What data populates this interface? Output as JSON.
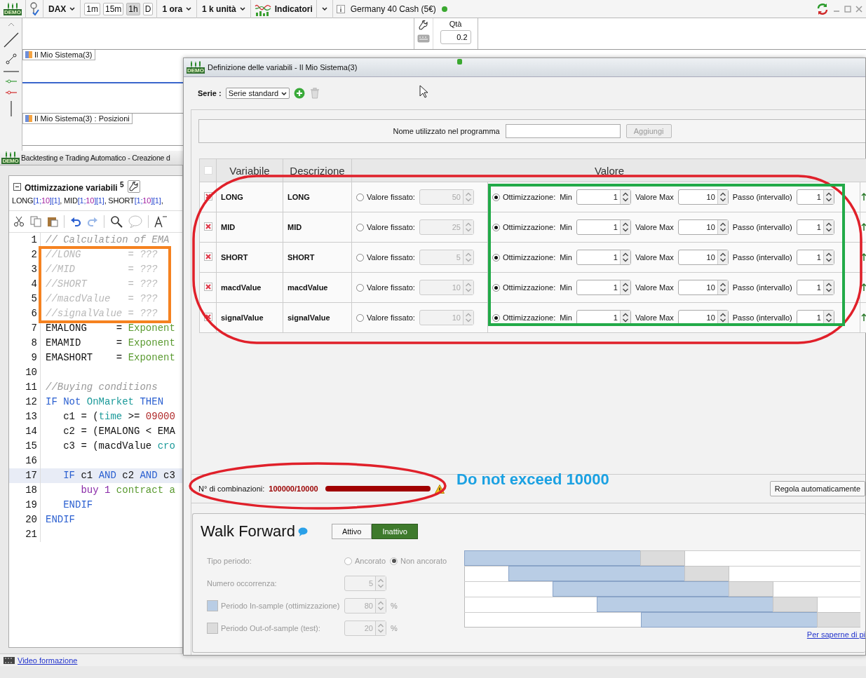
{
  "toolbar": {
    "logo_text": "DEMO",
    "symbol": "DAX",
    "timeframes": [
      {
        "label": "1m",
        "selected": false
      },
      {
        "label": "15m",
        "selected": false
      },
      {
        "label": "1h",
        "selected": true
      },
      {
        "label": "D",
        "selected": false
      }
    ],
    "period": "1 ora",
    "units": "1 k unità",
    "indicators": "Indicatori",
    "instrument": "Germany 40 Cash (5€)"
  },
  "order_panel": {
    "quantity_label": "Qtà",
    "quantity": "0.2"
  },
  "chart_panels": [
    {
      "label": "Il Mio Sistema(3)"
    },
    {
      "label": "Il Mio Sistema(3) : Posizioni"
    }
  ],
  "backtest_window": {
    "logo_text": "DEMO",
    "title": "Backtesting e Trading Automatico - Creazione d",
    "section_title": "Ottimizzazione variabili $^{5}$",
    "variables_summary": [
      {
        "text": "LONG",
        "kind": "name"
      },
      {
        "text": "[1;",
        "kind": "bracket"
      },
      {
        "text": "10",
        "kind": "max"
      },
      {
        "text": "][1]",
        "kind": "bracket"
      },
      {
        "text": ", MID",
        "kind": "name"
      },
      {
        "text": "[1;",
        "kind": "bracket"
      },
      {
        "text": "10",
        "kind": "max"
      },
      {
        "text": "][1]",
        "kind": "bracket"
      },
      {
        "text": ", SHORT",
        "kind": "name"
      },
      {
        "text": "[1;",
        "kind": "bracket"
      },
      {
        "text": "10",
        "kind": "max"
      },
      {
        "text": "][1]",
        "kind": "bracket"
      },
      {
        "text": ",",
        "kind": "name"
      }
    ],
    "code": [
      {
        "number": "1",
        "highlighted": false,
        "tokens": [
          {
            "text": "// Calculation of EMA",
            "kind": "comment"
          }
        ]
      },
      {
        "number": "2",
        "highlighted": false,
        "tokens": [
          {
            "text": "//LONG        = ???",
            "kind": "disabled"
          }
        ]
      },
      {
        "number": "3",
        "highlighted": false,
        "tokens": [
          {
            "text": "//MID         = ???",
            "kind": "disabled"
          }
        ]
      },
      {
        "number": "4",
        "highlighted": false,
        "tokens": [
          {
            "text": "//SHORT       = ???",
            "kind": "disabled"
          }
        ]
      },
      {
        "number": "5",
        "highlighted": false,
        "tokens": [
          {
            "text": "//macdValue   = ???",
            "kind": "disabled"
          }
        ]
      },
      {
        "number": "6",
        "highlighted": false,
        "tokens": [
          {
            "text": "//signalValue = ???",
            "kind": "disabled"
          }
        ]
      },
      {
        "number": "7",
        "highlighted": false,
        "tokens": [
          {
            "text": "EMALONG     = ",
            "kind": "plain"
          },
          {
            "text": "Exponent",
            "kind": "function"
          }
        ]
      },
      {
        "number": "8",
        "highlighted": false,
        "tokens": [
          {
            "text": "EMAMID      = ",
            "kind": "plain"
          },
          {
            "text": "Exponent",
            "kind": "function"
          }
        ]
      },
      {
        "number": "9",
        "highlighted": false,
        "tokens": [
          {
            "text": "EMASHORT    = ",
            "kind": "plain"
          },
          {
            "text": "Exponent",
            "kind": "function"
          }
        ]
      },
      {
        "number": "10",
        "highlighted": false
      },
      {
        "number": "11",
        "highlighted": false,
        "tokens": [
          {
            "text": "//Buying conditions",
            "kind": "comment"
          }
        ]
      },
      {
        "number": "12",
        "highlighted": false,
        "tokens": [
          {
            "text": "IF Not ",
            "kind": "keyword"
          },
          {
            "text": "OnMarket",
            "kind": "builtin"
          },
          {
            "text": " THEN",
            "kind": "keyword"
          }
        ]
      },
      {
        "number": "13",
        "highlighted": false,
        "tokens": [
          {
            "text": "   c1 = (",
            "kind": "plain"
          },
          {
            "text": "time",
            "kind": "builtin"
          },
          {
            "text": " >= ",
            "kind": "plain"
          },
          {
            "text": "09000",
            "kind": "number"
          }
        ]
      },
      {
        "number": "14",
        "highlighted": false,
        "tokens": [
          {
            "text": "   c2 = (EMALONG < EMA",
            "kind": "plain"
          }
        ]
      },
      {
        "number": "15",
        "highlighted": false,
        "tokens": [
          {
            "text": "   c3 = (macdValue ",
            "kind": "plain"
          },
          {
            "text": "cro",
            "kind": "builtin"
          }
        ]
      },
      {
        "number": "16",
        "highlighted": false
      },
      {
        "number": "17",
        "highlighted": true,
        "tokens": [
          {
            "text": "   IF",
            "kind": "keyword"
          },
          {
            "text": " c1 ",
            "kind": "plain"
          },
          {
            "text": "AND",
            "kind": "keyword"
          },
          {
            "text": " c2 ",
            "kind": "plain"
          },
          {
            "text": "AND",
            "kind": "keyword"
          },
          {
            "text": " c3",
            "kind": "plain"
          }
        ]
      },
      {
        "number": "18",
        "highlighted": false,
        "tokens": [
          {
            "text": "      buy 1",
            "kind": "order"
          },
          {
            "text": " contract a",
            "kind": "function"
          }
        ]
      },
      {
        "number": "19",
        "highlighted": false,
        "tokens": [
          {
            "text": "   ENDIF",
            "kind": "keyword"
          }
        ]
      },
      {
        "number": "20",
        "highlighted": false,
        "tokens": [
          {
            "text": "ENDIF",
            "kind": "keyword"
          }
        ]
      },
      {
        "number": "21",
        "highlighted": false
      }
    ]
  },
  "dialog": {
    "logo_text": "DEMO",
    "title": "Definizione delle variabili - Il Mio Sistema(3)",
    "series_label": "Serie :",
    "series_value": "Serie standard",
    "name_label": "Nome utilizzato nel programma",
    "add_button": "Aggiungi",
    "add_disabled": true,
    "columns": [
      "Variabile",
      "Descrizione",
      "Valore"
    ],
    "variables": [
      {
        "name": "LONG",
        "description": "LONG",
        "fixed_label": "Valore fissato:",
        "fixed_value": "50",
        "optimized": true,
        "opt_label": "Ottimizzazione:",
        "min_label": "Min",
        "min": "1",
        "max_label": "Valore Max",
        "max": "10",
        "step_label": "Passo (intervallo)",
        "step": "1"
      },
      {
        "name": "MID",
        "description": "MID",
        "fixed_label": "Valore fissato:",
        "fixed_value": "25",
        "optimized": true,
        "opt_label": "Ottimizzazione:",
        "min_label": "Min",
        "min": "1",
        "max_label": "Valore Max",
        "max": "10",
        "step_label": "Passo (intervallo)",
        "step": "1"
      },
      {
        "name": "SHORT",
        "description": "SHORT",
        "fixed_label": "Valore fissato:",
        "fixed_value": "5",
        "optimized": true,
        "opt_label": "Ottimizzazione:",
        "min_label": "Min",
        "min": "1",
        "max_label": "Valore Max",
        "max": "10",
        "step_label": "Passo (intervallo)",
        "step": "1"
      },
      {
        "name": "macdValue",
        "description": "macdValue",
        "fixed_label": "Valore fissato:",
        "fixed_value": "10",
        "optimized": true,
        "opt_label": "Ottimizzazione:",
        "min_label": "Min",
        "min": "1",
        "max_label": "Valore Max",
        "max": "10",
        "step_label": "Passo (intervallo)",
        "step": "1"
      },
      {
        "name": "signalValue",
        "description": "signalValue",
        "fixed_label": "Valore fissato:",
        "fixed_value": "10",
        "optimized": true,
        "opt_label": "Ottimizzazione:",
        "min_label": "Min",
        "min": "1",
        "max_label": "Valore Max",
        "max": "10",
        "step_label": "Passo (intervallo)",
        "step": "1"
      }
    ],
    "combinations": {
      "label": "N° di combinazioni:",
      "value": "100000/10000",
      "level": 1
    },
    "auto_button": "Regola automaticamente",
    "walk_forward": {
      "title": "Walk Forward",
      "options": [
        {
          "label": "Attivo",
          "selected": false
        },
        {
          "label": "Inattivo",
          "selected": true
        }
      ],
      "disabled": true,
      "period_type": {
        "label": "Tipo periodo:",
        "choices": [
          {
            "label": "Ancorato",
            "selected": false
          },
          {
            "label": "Non ancorato",
            "selected": true
          }
        ]
      },
      "occurrences": {
        "label": "Numero occorrenza:",
        "value": "5"
      },
      "in_sample": {
        "label": "Periodo In-sample (ottimizzazione)",
        "value": "80",
        "unit": "%",
        "color": "#b9cde5"
      },
      "out_sample": {
        "label": "Periodo Out-of-sample (test):",
        "value": "20",
        "unit": "%",
        "color": "#dcdcdc"
      },
      "link": "Per saperne di pi"
    }
  },
  "status_bar": {
    "link": "Video formazione"
  },
  "annotations": [
    {
      "kind": "rectangle",
      "color": "#f58220"
    },
    {
      "kind": "ellipse",
      "color": "#e0202a"
    },
    {
      "kind": "rectangle",
      "color": "#22aa48"
    },
    {
      "kind": "ellipse",
      "color": "#e0202a"
    },
    {
      "kind": "text",
      "text": "Do not exceed 10000",
      "color": "#1ba1e2"
    }
  ]
}
